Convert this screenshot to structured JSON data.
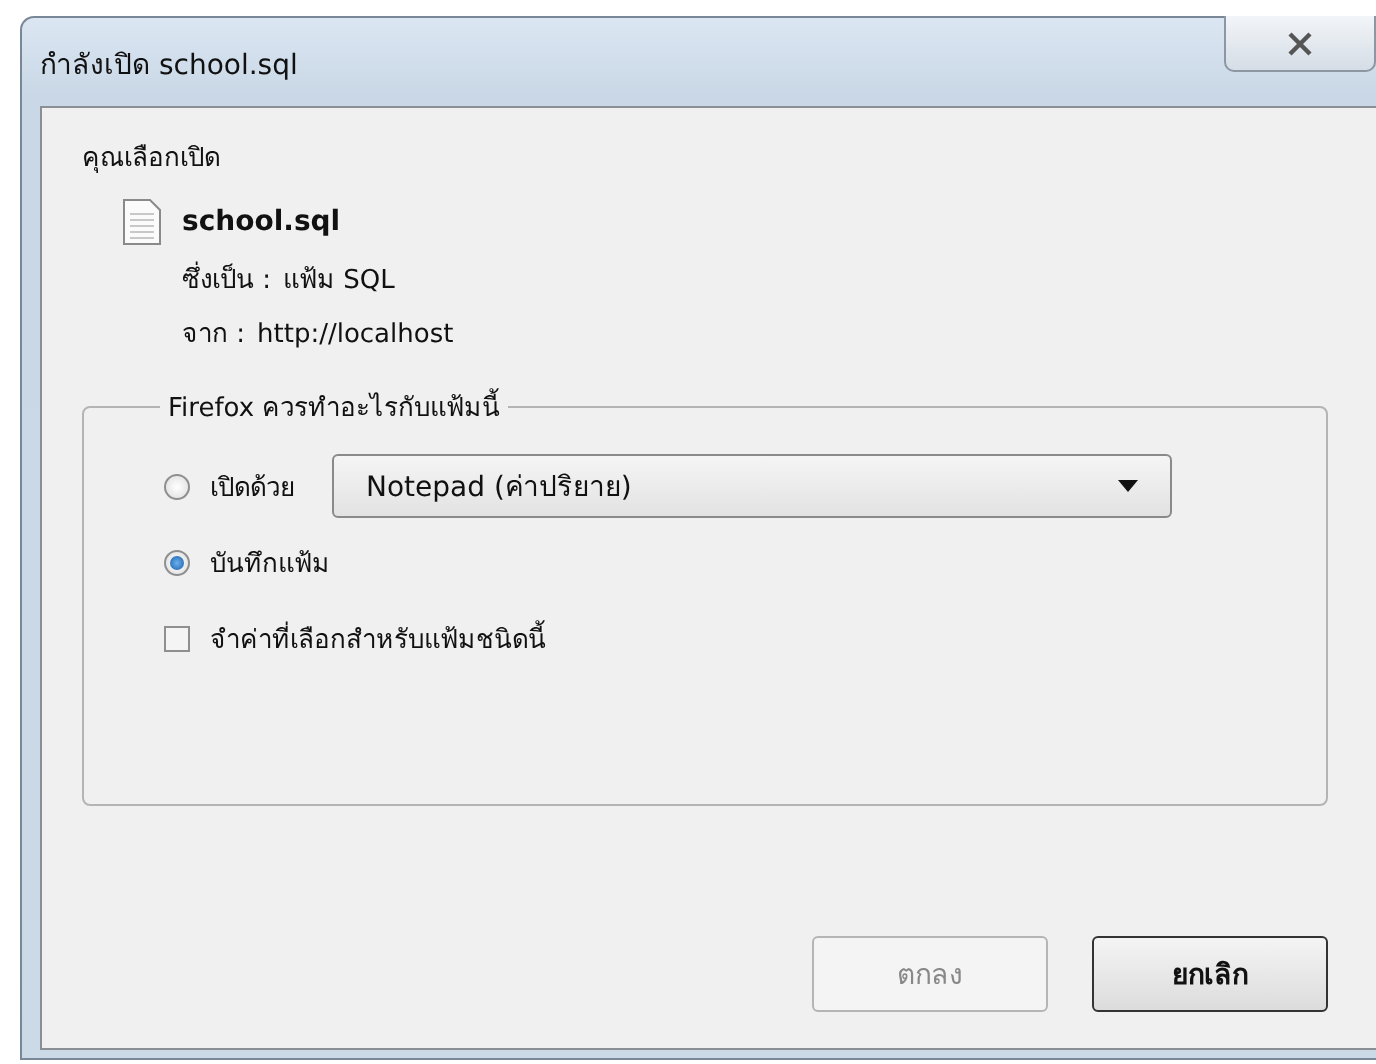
{
  "window": {
    "title": "กำลังเปิด school.sql"
  },
  "intro": "คุณเลือกเปิด",
  "file": {
    "name": "school.sql",
    "type_label": "ซึ่งเป็น :",
    "type_value": "แฟ้ม SQL",
    "from_label": "จาก :",
    "from_value": "http://localhost"
  },
  "action_group": {
    "legend": "Firefox ควรทำอะไรกับแฟ้มนี้",
    "options": [
      {
        "kind": "radio",
        "label": "เปิดด้วย",
        "selected": false,
        "dropdown": "Notepad (ค่าปริยาย)"
      },
      {
        "kind": "radio",
        "label": "บันทึกแฟ้ม",
        "selected": true
      },
      {
        "kind": "checkbox",
        "label": "จำค่าที่เลือกสำหรับแฟ้มชนิดนี้",
        "checked": false
      }
    ]
  },
  "buttons": [
    {
      "label": "ตกลง",
      "disabled": true,
      "default": false
    },
    {
      "label": "ยกเลิก",
      "disabled": false,
      "default": true
    }
  ]
}
